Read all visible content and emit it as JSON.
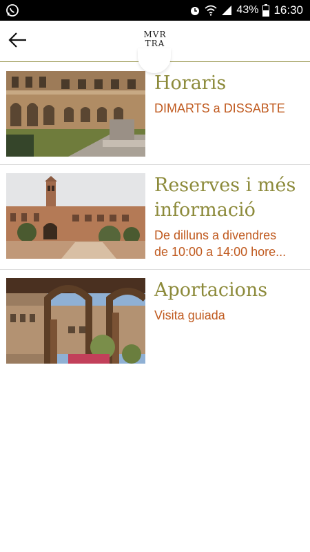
{
  "status_bar": {
    "battery": "43%",
    "time": "16:30",
    "icons": [
      "whatsapp-icon",
      "alarm-icon",
      "wifi-icon",
      "signal-icon",
      "battery-icon"
    ]
  },
  "header": {
    "back_icon": "arrow-left-icon",
    "logo_line1": "MVR",
    "logo_line2": "TRA",
    "accent_color": "#8c8a3a"
  },
  "items": [
    {
      "title": "Horaris",
      "lines": [
        "DIMARTS a DISSABTE"
      ]
    },
    {
      "title": "Reserves i més informació",
      "lines": [
        "De dilluns a divendres",
        "de 10:00 a 14:00 hore..."
      ]
    },
    {
      "title": "Aportacions",
      "lines": [
        "Visita guiada"
      ]
    }
  ],
  "colors": {
    "title": "#8c8a3a",
    "subtitle": "#c05a1f"
  }
}
